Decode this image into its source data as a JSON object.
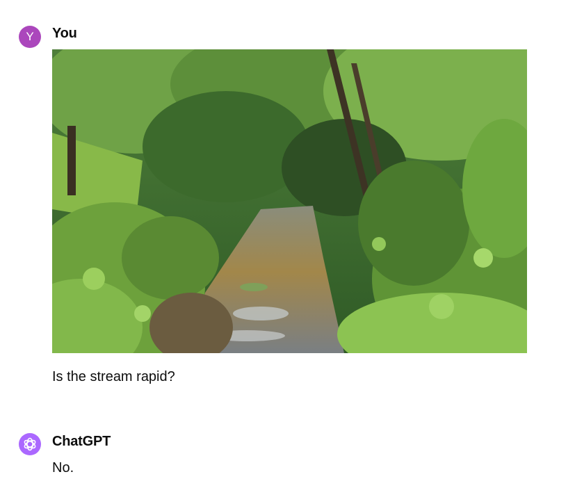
{
  "conversation": {
    "user": {
      "avatar_letter": "Y",
      "name": "You",
      "avatar_color": "#ab47bc",
      "image": {
        "icon": "stream-photo"
      },
      "message": "Is the stream rapid?"
    },
    "assistant": {
      "name": "ChatGPT",
      "avatar_color": "#ab68ff",
      "avatar_icon": "openai-logo-icon",
      "message": "No."
    }
  }
}
